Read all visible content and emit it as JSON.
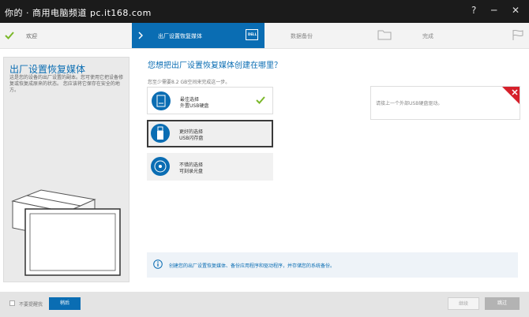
{
  "watermark": "你的 · 商用电脑频道 pc.it168.com",
  "window": {
    "help": "?",
    "minimize": "─",
    "close": "✕"
  },
  "steps": [
    {
      "label": "欢迎",
      "state": "done"
    },
    {
      "label": "出厂设置恢复媒体",
      "state": "active"
    },
    {
      "label": "数据备份",
      "state": "pending"
    },
    {
      "label": "完成",
      "state": "pending"
    }
  ],
  "left": {
    "title": "出厂设置恢复媒体",
    "description": "这是您的设备的出厂设置的副本。您可使用它把设备修复或恢复成原来的状态。 您应该将它保存在安全的地方。"
  },
  "main": {
    "question": "您想把出厂设置恢复媒体创建在哪里？",
    "requirement": "您至少需要8.2 GB空间来完成这一步。",
    "options": [
      {
        "line1": "最佳选择",
        "line2": "外置USB硬盘",
        "icon": "usb-hdd-icon"
      },
      {
        "line1": "更好的选择",
        "line2": "USB闪存盘",
        "icon": "usb-flash-icon"
      },
      {
        "line1": "不错的选择",
        "line2": "可刻录光盘",
        "icon": "disc-icon"
      }
    ],
    "drive_message": "请接上一个外部USB硬盘驱动。",
    "info": "创建您的出厂设置恢复媒体、备份应用程序和驱动程序，并存储您的系统备份。"
  },
  "footer": {
    "checkbox_label": "不要提醒我",
    "back": "稍后",
    "next": "继续",
    "cancel": "跳过"
  },
  "colors": {
    "accent": "#0a6db3",
    "titlebar": "#1b1b1b",
    "check": "#7bb82a",
    "error": "#d6202b"
  }
}
